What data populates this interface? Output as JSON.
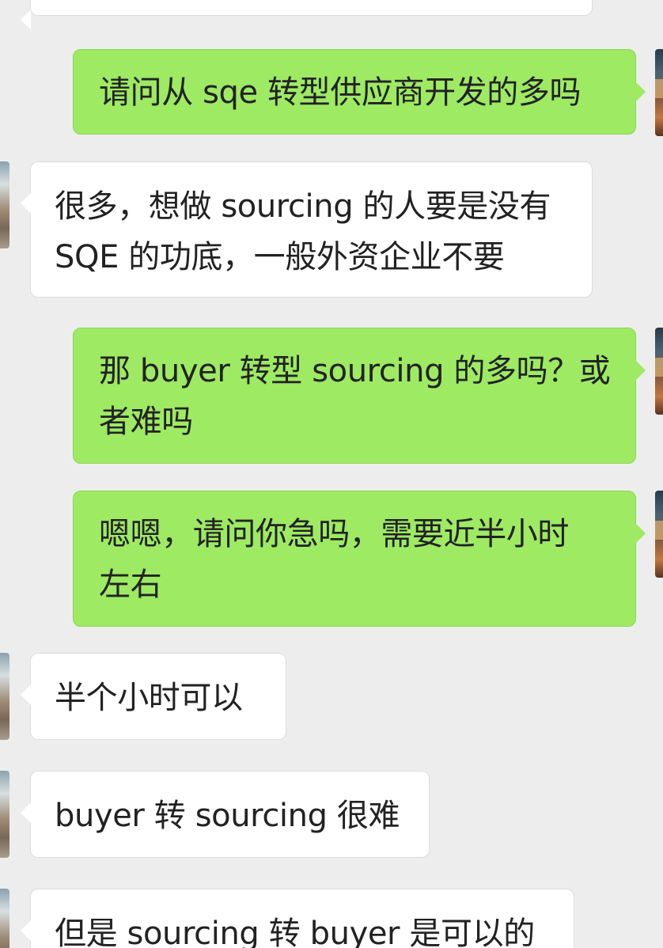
{
  "chat": {
    "messages": [
      {
        "side": "sent",
        "lines": [
          "请问从 sqe 转型供应商开发的多吗"
        ]
      },
      {
        "side": "received",
        "lines": [
          "很多，想做 sourcing 的人要是没有",
          "SQE 的功底，一般外资企业不要"
        ]
      },
      {
        "side": "sent",
        "lines": [
          "那 buyer 转型 sourcing 的多吗？或",
          "者难吗"
        ]
      },
      {
        "side": "sent",
        "lines": [
          "嗯嗯，请问你急吗，需要近半小时",
          "左右"
        ]
      },
      {
        "side": "received",
        "lines": [
          "半个小时可以"
        ]
      },
      {
        "side": "received",
        "lines": [
          "buyer 转 sourcing 很难"
        ]
      },
      {
        "side": "received",
        "lines": [
          "但是 sourcing 转 buyer 是可以的"
        ]
      }
    ]
  }
}
